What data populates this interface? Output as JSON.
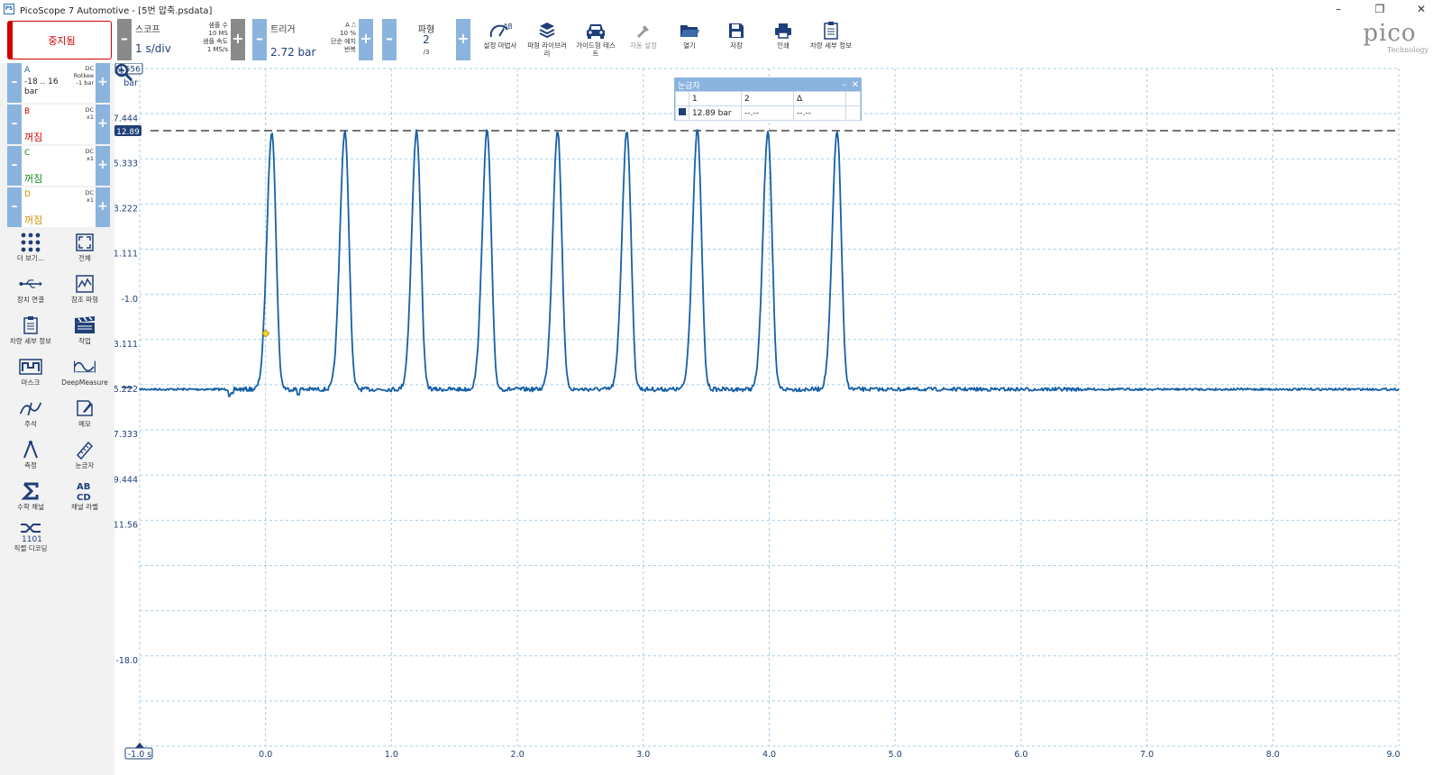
{
  "window": {
    "title": "PicoScope 7 Automotive - [5번 압축.psdata]",
    "icon_text": "PS",
    "minimize": "–",
    "maximize": "❐",
    "close": "✕"
  },
  "toolbar": {
    "stop_label": "중지됨",
    "scope": {
      "label": "스코프",
      "value": "1 s/div",
      "samples_label": "샘플 수",
      "samples_value": "10 MS",
      "rate_label": "샘플 속도",
      "rate_value": "1 MS/s"
    },
    "trigger": {
      "label": "트리거",
      "value": "2.72 bar",
      "channel": "A",
      "percent": "10 %",
      "type": "단순 에지",
      "mode": "반복"
    },
    "waveform": {
      "label": "파형",
      "value": "2",
      "total": "/3"
    },
    "buttons": [
      {
        "label": "설정 마법사",
        "icon": "wizard-icon"
      },
      {
        "label": "파형 라이브러리",
        "icon": "library-icon"
      },
      {
        "label": "가이드형 테스트",
        "icon": "car-icon"
      },
      {
        "label": "자동 설정",
        "icon": "auto-setup-icon"
      },
      {
        "label": "열기",
        "icon": "folder-icon"
      },
      {
        "label": "저장",
        "icon": "save-icon"
      },
      {
        "label": "인쇄",
        "icon": "print-icon"
      },
      {
        "label": "차량 세부 정보",
        "icon": "clipboard-icon"
      }
    ],
    "logo": "pico",
    "logo_sub": "Technology"
  },
  "channels": [
    {
      "letter": "A",
      "range": "-18 .. 16",
      "unit": "bar",
      "coupling": "DC",
      "probe": "Rotkee",
      "scale": "-1 bar",
      "state": "",
      "color": "#1f5fa8"
    },
    {
      "letter": "B",
      "range": "",
      "unit": "",
      "coupling": "DC",
      "probe": "",
      "scale": "x1",
      "state": "꺼짐",
      "color": "#d10000"
    },
    {
      "letter": "C",
      "range": "",
      "unit": "",
      "coupling": "DC",
      "probe": "",
      "scale": "x1",
      "state": "꺼짐",
      "color": "#0a8a1a"
    },
    {
      "letter": "D",
      "range": "",
      "unit": "",
      "coupling": "DC",
      "probe": "",
      "scale": "x1",
      "state": "꺼짐",
      "color": "#c89000"
    }
  ],
  "left_tools": [
    {
      "label": "더 보기...",
      "icon": "grid-dots-icon"
    },
    {
      "label": "전체",
      "icon": "fullscreen-icon"
    },
    {
      "label": "장치 연결",
      "icon": "usb-icon"
    },
    {
      "label": "참조 파형",
      "icon": "reference-waveform-icon"
    },
    {
      "label": "차량 세부 정보",
      "icon": "clipboard-icon"
    },
    {
      "label": "작업",
      "icon": "clapper-icon"
    },
    {
      "label": "마스크",
      "icon": "mask-icon"
    },
    {
      "label": "DeepMeasure",
      "icon": "deepmeasure-icon"
    },
    {
      "label": "주석",
      "icon": "annotation-icon"
    },
    {
      "label": "메모",
      "icon": "notes-icon"
    },
    {
      "label": "측정",
      "icon": "measure-icon"
    },
    {
      "label": "눈금자",
      "icon": "ruler-icon"
    },
    {
      "label": "수학 채널",
      "icon": "sigma-icon"
    },
    {
      "label": "채널 라벨",
      "icon": "channel-labels-icon"
    },
    {
      "label": "직렬 디코딩",
      "icon": "serial-decoding-icon"
    }
  ],
  "plot": {
    "y_top_label": "9.556",
    "y_unit": "bar",
    "ruler_marker_label": "12.89",
    "y_ticks": [
      "7.444",
      "5.333",
      "3.222",
      "1.111",
      "-1.0",
      "-3.111",
      "-5.222",
      "-7.333",
      "-9.444",
      "-11.56",
      "-18.0"
    ],
    "x_ticks": [
      "-1.0 s",
      "0.0",
      "1.0",
      "2.0",
      "3.0",
      "4.0",
      "5.0",
      "6.0",
      "7.0",
      "8.0",
      "9.0"
    ],
    "trace_color": "#1560a8",
    "ruler_color": "#222222"
  },
  "ruler_window": {
    "title": "눈금자",
    "min": "–",
    "close": "✕",
    "headers": [
      "",
      "1",
      "2",
      "Δ"
    ],
    "row": [
      "",
      "12.89 bar",
      "--.--",
      "--.--"
    ]
  }
}
